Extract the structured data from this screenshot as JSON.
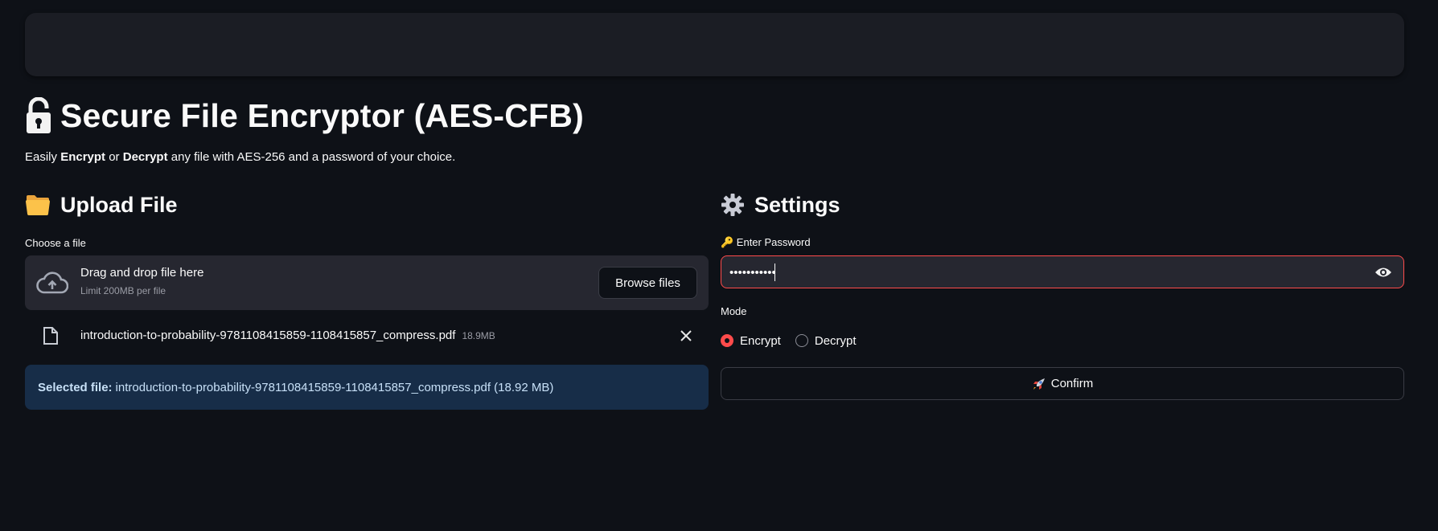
{
  "title": "Secure File Encryptor (AES-CFB)",
  "subtitle": {
    "p1": "Easily ",
    "b1": "Encrypt",
    "p2": " or ",
    "b2": "Decrypt",
    "p3": " any file with AES-256 and a password of your choice."
  },
  "upload": {
    "heading": "Upload File",
    "label": "Choose a file",
    "drop_text": "Drag and drop file here",
    "limit_text": "Limit 200MB per file",
    "browse_label": "Browse files",
    "file_name": "introduction-to-probability-9781108415859-1108415857_compress.pdf",
    "file_size": "18.9MB",
    "selected_prefix": "Selected file:",
    "selected_value": "introduction-to-probability-9781108415859-1108415857_compress.pdf (18.92 MB)"
  },
  "settings": {
    "heading": "Settings",
    "password_label": "🔑 Enter Password",
    "password_value": "•••••••••••",
    "mode_label": "Mode",
    "mode_options": [
      "Encrypt",
      "Decrypt"
    ],
    "mode_selected": "Encrypt",
    "confirm_label": "Confirm"
  },
  "colors": {
    "background": "#0e1117",
    "accent": "#ff4b4b",
    "info_bg": "#172d48",
    "info_text": "#c7e0f7"
  },
  "icons": {
    "title": "lock-icon",
    "upload": "folder-icon",
    "settings": "gear-icon",
    "dropzone": "cloud-upload-icon",
    "file": "document-icon",
    "remove": "close-icon",
    "visibility": "eye-icon",
    "confirm": "rocket-icon"
  }
}
